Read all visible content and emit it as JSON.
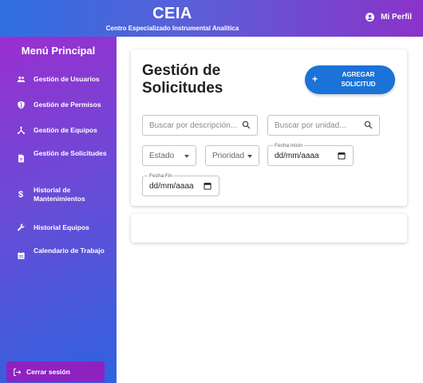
{
  "header": {
    "title": "CEIA",
    "subtitle": "Centro Especializado Instrumental Analítica",
    "profile_label": "Mi Perfil"
  },
  "sidebar": {
    "title": "Menú Principal",
    "items": [
      {
        "label": "Gestión de Usuarios",
        "icon": "users-icon"
      },
      {
        "label": "Gestión de Permisos",
        "icon": "shield-icon"
      },
      {
        "label": "Gestión de Equipos",
        "icon": "network-icon"
      },
      {
        "label": "Gestión de Solicitudes",
        "icon": "document-icon"
      },
      {
        "label": "Historial de Mantenimientos",
        "icon": "dollar-icon"
      },
      {
        "label": "Historial Equipos",
        "icon": "wrench-icon"
      },
      {
        "label": "Calendario de Trabajo",
        "icon": "calendar-icon"
      }
    ],
    "logout_label": "Cerrar sesión"
  },
  "main": {
    "title": "Gestión de Solicitudes",
    "add_button_label": "AGREGAR SOLICITUD",
    "search_description_placeholder": "Buscar por descripción...",
    "search_unit_placeholder": "Buscar por unidad...",
    "estado_label": "Estado",
    "prioridad_label": "Prioridad",
    "fecha_inicio_label": "Fecha Inicio",
    "fecha_inicio_value": "dd/mm/aaaa",
    "fecha_fin_label": "Fecha Fin",
    "fecha_fin_value": "dd/mm/aaaa"
  },
  "colors": {
    "accent_blue": "#1b72d8",
    "sidebar_purple": "#9a2fd0",
    "logout_purple": "#8e22bf"
  }
}
